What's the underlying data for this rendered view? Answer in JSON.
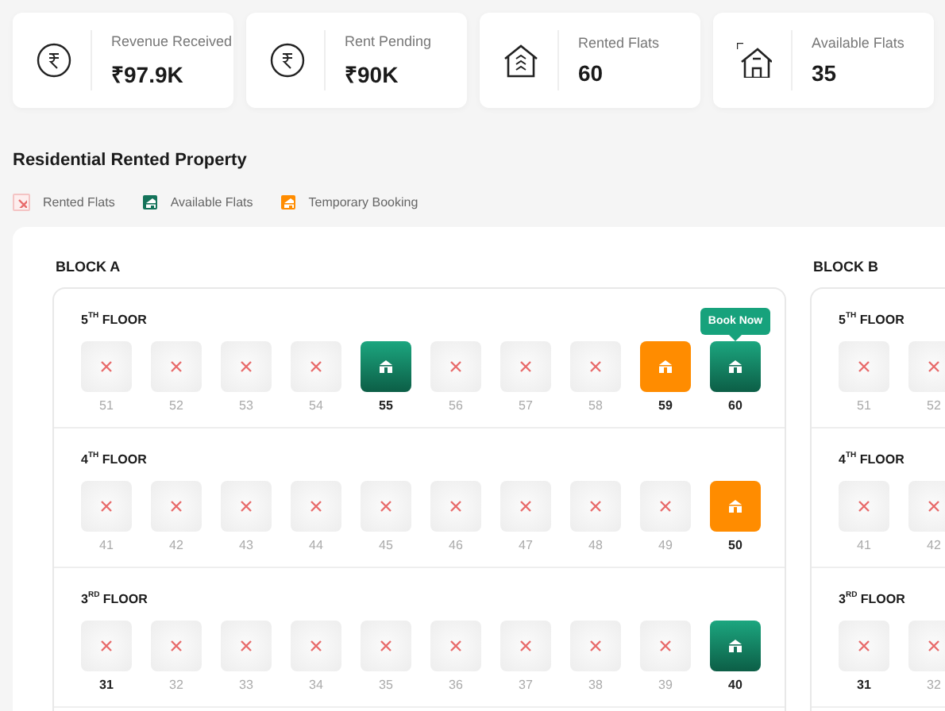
{
  "stats": [
    {
      "kind": "rupee",
      "label": "Revenue Received",
      "value": "₹97.9K"
    },
    {
      "kind": "rupee",
      "label": "Rent Pending",
      "value": "₹90K"
    },
    {
      "kind": "rented",
      "label": "Rented Flats",
      "value": "60"
    },
    {
      "kind": "available",
      "label": "Available Flats",
      "value": "35"
    }
  ],
  "section_title": "Residential Rented Property",
  "legend": [
    {
      "kind": "rented",
      "label": "Rented Flats"
    },
    {
      "kind": "available",
      "label": "Available Flats"
    },
    {
      "kind": "booking",
      "label": "Temporary Booking"
    }
  ],
  "blocks": [
    {
      "title": "BLOCK A",
      "floors": [
        {
          "label": "5$^{TH}$ FLOOR",
          "flats": [
            {
              "number": "51",
              "kind": "rented",
              "bold": false
            },
            {
              "number": "52",
              "kind": "rented",
              "bold": false
            },
            {
              "number": "53",
              "kind": "rented",
              "bold": false
            },
            {
              "number": "54",
              "kind": "rented",
              "bold": false
            },
            {
              "number": "55",
              "kind": "available",
              "bold": true
            },
            {
              "number": "56",
              "kind": "rented",
              "bold": false
            },
            {
              "number": "57",
              "kind": "rented",
              "bold": false
            },
            {
              "number": "58",
              "kind": "rented",
              "bold": false
            },
            {
              "number": "59",
              "kind": "booking",
              "bold": true
            },
            {
              "number": "60",
              "kind": "available",
              "bold": true,
              "tooltip": "Book Now"
            }
          ]
        },
        {
          "label": "4$^{TH}$ FLOOR",
          "flats": [
            {
              "number": "41",
              "kind": "rented",
              "bold": false
            },
            {
              "number": "42",
              "kind": "rented",
              "bold": false
            },
            {
              "number": "43",
              "kind": "rented",
              "bold": false
            },
            {
              "number": "44",
              "kind": "rented",
              "bold": false
            },
            {
              "number": "45",
              "kind": "rented",
              "bold": false
            },
            {
              "number": "46",
              "kind": "rented",
              "bold": false
            },
            {
              "number": "47",
              "kind": "rented",
              "bold": false
            },
            {
              "number": "48",
              "kind": "rented",
              "bold": false
            },
            {
              "number": "49",
              "kind": "rented",
              "bold": false
            },
            {
              "number": "50",
              "kind": "booking",
              "bold": true
            }
          ]
        },
        {
          "label": "3$^{RD}$ FLOOR",
          "flats": [
            {
              "number": "31",
              "kind": "rented",
              "bold": true
            },
            {
              "number": "32",
              "kind": "rented",
              "bold": false
            },
            {
              "number": "33",
              "kind": "rented",
              "bold": false
            },
            {
              "number": "34",
              "kind": "rented",
              "bold": false
            },
            {
              "number": "35",
              "kind": "rented",
              "bold": false
            },
            {
              "number": "36",
              "kind": "rented",
              "bold": false
            },
            {
              "number": "37",
              "kind": "rented",
              "bold": false
            },
            {
              "number": "38",
              "kind": "rented",
              "bold": false
            },
            {
              "number": "39",
              "kind": "rented",
              "bold": false
            },
            {
              "number": "40",
              "kind": "available",
              "bold": true
            }
          ]
        }
      ]
    },
    {
      "title": "BLOCK B",
      "floors": [
        {
          "label": "5$^{TH}$ FLOOR",
          "flats": [
            {
              "number": "51",
              "kind": "rented",
              "bold": false
            },
            {
              "number": "52",
              "kind": "rented",
              "bold": false
            }
          ]
        },
        {
          "label": "4$^{TH}$ FLOOR",
          "flats": [
            {
              "number": "41",
              "kind": "rented",
              "bold": false
            },
            {
              "number": "42",
              "kind": "rented",
              "bold": false
            }
          ]
        },
        {
          "label": "3$^{RD}$ FLOOR",
          "flats": [
            {
              "number": "31",
              "kind": "rented",
              "bold": true
            },
            {
              "number": "32",
              "kind": "rented",
              "bold": false
            }
          ]
        }
      ]
    }
  ]
}
